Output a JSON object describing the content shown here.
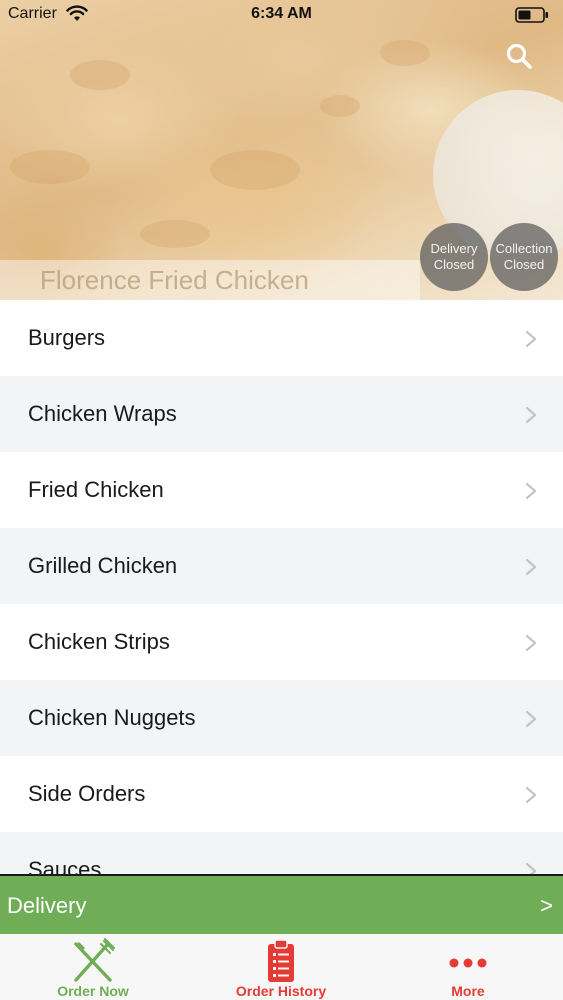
{
  "status_bar": {
    "carrier": "Carrier",
    "time": "6:34 AM",
    "wifi_icon": "wifi-icon",
    "battery_icon": "battery-icon"
  },
  "hero": {
    "restaurant_name": "Florence Fried Chicken",
    "search_icon": "search-icon",
    "delivery_status": {
      "line1": "Delivery",
      "line2": "Closed"
    },
    "collection_status": {
      "line1": "Collection",
      "line2": "Closed"
    }
  },
  "categories": [
    {
      "label": "Burgers"
    },
    {
      "label": "Chicken Wraps"
    },
    {
      "label": "Fried Chicken"
    },
    {
      "label": "Grilled Chicken"
    },
    {
      "label": "Chicken Strips"
    },
    {
      "label": "Chicken Nuggets"
    },
    {
      "label": "Side Orders"
    },
    {
      "label": "Sauces"
    }
  ],
  "delivery_bar": {
    "label": "Delivery",
    "arrow": ">"
  },
  "tabs": [
    {
      "label": "Order Now",
      "icon": "fork-knife-icon"
    },
    {
      "label": "Order History",
      "icon": "clipboard-list-icon"
    },
    {
      "label": "More",
      "icon": "more-dots-icon"
    }
  ],
  "colors": {
    "accent_green": "#6fae57",
    "accent_red": "#e43b34",
    "status_circle": "#5a5a5a"
  }
}
